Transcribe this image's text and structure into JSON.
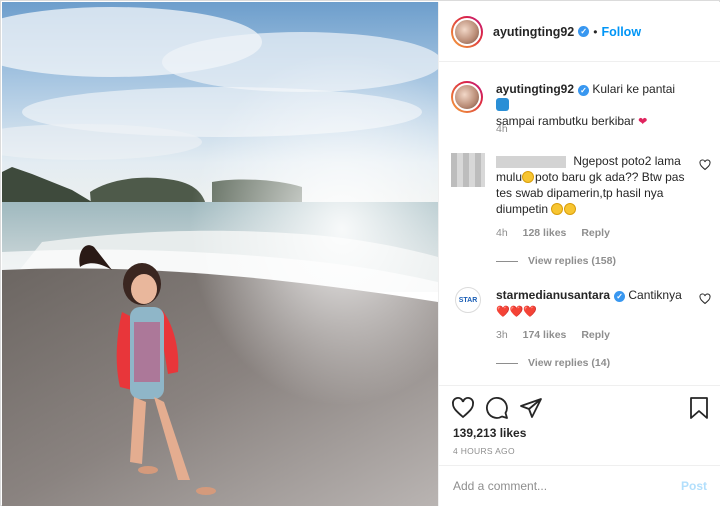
{
  "post": {
    "username": "ayutingting92",
    "follow_label": "Follow",
    "dot": "•"
  },
  "caption": {
    "username": "ayutingting92",
    "text_line1": "Kulari ke pantai",
    "text_line2": "sampai rambutku berkibar",
    "time": "4h"
  },
  "comments": [
    {
      "text": "Ngepost poto2 lama mulu",
      "text2": "poto baru gk ada?? Btw pas tes swab dipamerin,tp hasil nya diumpetin",
      "time": "4h",
      "likes": "128 likes",
      "reply": "Reply",
      "view_replies": "View replies (158)"
    },
    {
      "username": "starmedianusantara",
      "text": "Cantiknya",
      "time": "3h",
      "likes": "174 likes",
      "reply": "Reply",
      "view_replies": "View replies (14)",
      "avatar_text": "STAR"
    }
  ],
  "actions": {
    "likes": "139,213 likes",
    "ago": "4 HOURS AGO"
  },
  "add_comment": {
    "placeholder": "Add a comment...",
    "post_label": "Post"
  },
  "colors": {
    "accent": "#0095f6",
    "verified": "#3897f0",
    "muted": "#8e8e8e"
  },
  "icons": [
    "verified-badge-icon",
    "heart-icon",
    "comment-icon",
    "share-icon",
    "bookmark-icon",
    "wave-emoji-icon",
    "heart-emoji-icon",
    "grin-emoji-icon"
  ]
}
